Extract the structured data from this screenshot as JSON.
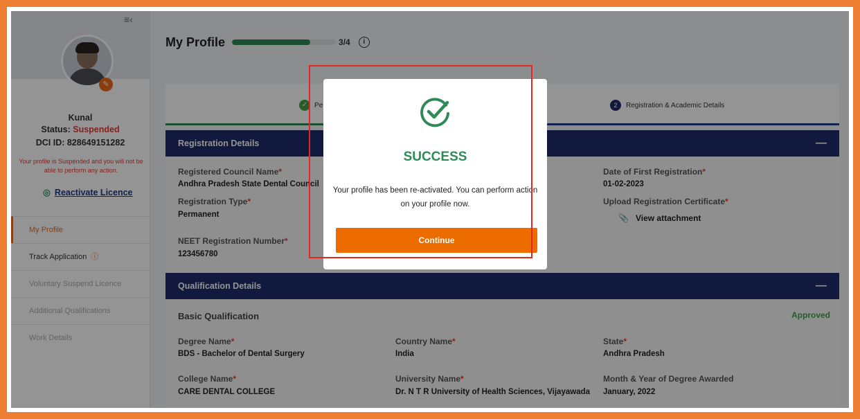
{
  "sidebar": {
    "user_name": "Kunal",
    "status_label": "Status:",
    "status_value": "Suspended",
    "dci_id": "DCI ID: 828649151282",
    "suspended_note": "Your profile is Suspended and you will not be able to perform any action.",
    "reactivate_label": "Reactivate Licence",
    "nav": [
      {
        "label": "My Profile"
      },
      {
        "label": "Track Application"
      },
      {
        "label": "Voluntary Suspend Licence"
      },
      {
        "label": "Additional Qualifications"
      },
      {
        "label": "Work Details"
      }
    ]
  },
  "header": {
    "title": "My Profile",
    "progress_text": "3/4",
    "progress_fraction": 0.75
  },
  "steps": {
    "step1_label": "Pe",
    "step2_num": "2",
    "step2_label": "Registration & Academic Details"
  },
  "registration": {
    "title": "Registration Details",
    "council_label": "Registered Council Name",
    "council_value": "Andhra Pradesh State Dental Council",
    "type_label": "Registration Type",
    "type_value": "Permanent",
    "neet_label": "NEET Registration Number",
    "neet_value": "123456780",
    "first_reg_label": "Date of First Registration",
    "first_reg_value": "01-02-2023",
    "upload_label": "Upload Registration Certificate",
    "attachment_label": "View attachment"
  },
  "qualification": {
    "title": "Qualification Details",
    "subhead": "Basic Qualification",
    "status": "Approved",
    "degree_label": "Degree Name",
    "degree_value": "BDS - Bachelor of Dental Surgery",
    "country_label": "Country Name",
    "country_value": "India",
    "state_label": "State",
    "state_value": "Andhra Pradesh",
    "college_label": "College Name",
    "college_value": "CARE DENTAL COLLEGE",
    "university_label": "University Name",
    "university_value": "Dr. N T R University of Health Sciences, Vijayawada",
    "awarded_label": "Month & Year of Degree Awarded",
    "awarded_value": "January, 2022"
  },
  "modal": {
    "title": "SUCCESS",
    "message": "Your profile has been re-activated. You can perform action on your profile now.",
    "button": "Continue"
  },
  "colors": {
    "accent": "#ed6c00",
    "navy": "#1e2d6b",
    "success": "#2e8b57",
    "frame": "#ed7d31",
    "highlight": "#e52520"
  }
}
